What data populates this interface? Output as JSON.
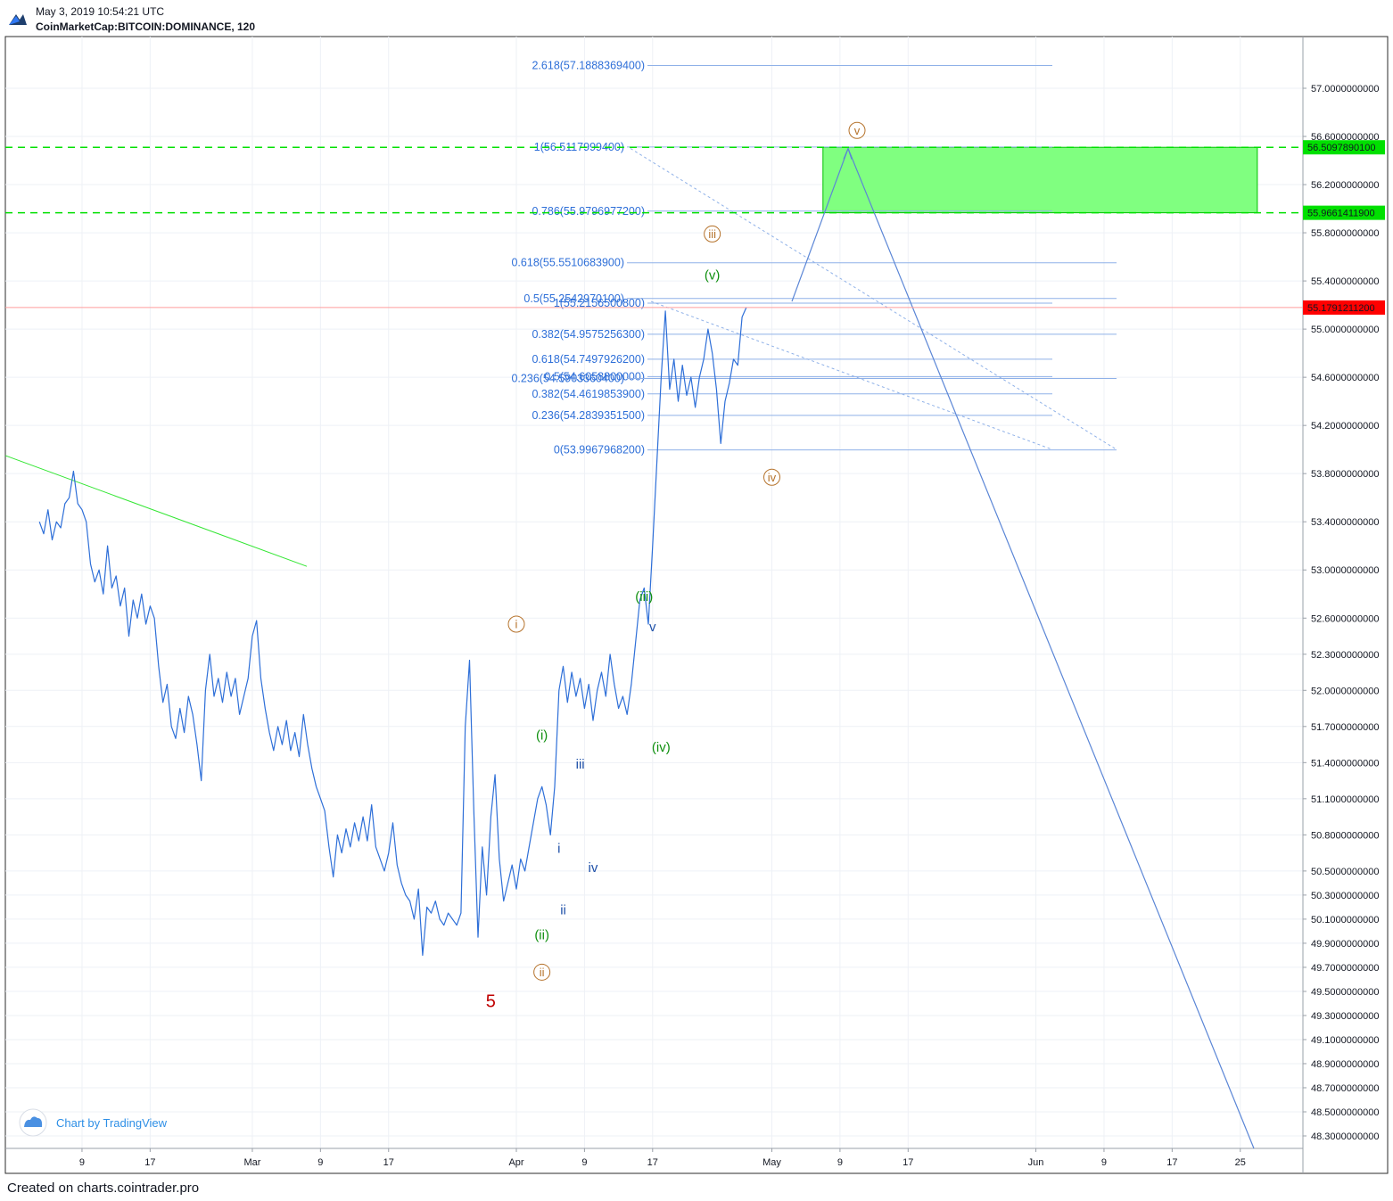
{
  "header": {
    "timestamp": "May 3, 2019 10:54:21 UTC",
    "symbol": "CoinMarketCap:BITCOIN:DOMINANCE, 120"
  },
  "footer": {
    "text": "Created on charts.cointrader.pro"
  },
  "watermark": {
    "text": "Chart by TradingView"
  },
  "colors": {
    "price_line": "#2e6fd8",
    "fib_line": "#8fb1e8",
    "fib_text": "#2e6fd8",
    "target_zone": "#80ff80",
    "target_border": "#00c000",
    "dashed_level": "#00e000",
    "last_price_badge": "#ff0000",
    "trend_line": "#33e633",
    "wave_orange": "#b5722b",
    "wave_green": "#109010",
    "wave_blue": "#1d4fa8",
    "wave_red": "#c00000"
  },
  "chart_data": {
    "type": "line",
    "x_axis": {
      "start_date": "2019-02-04",
      "end_date": "2019-06-30",
      "tick_labels": [
        "9",
        "17",
        "Mar",
        "9",
        "17",
        "Apr",
        "9",
        "17",
        "May",
        "9",
        "17",
        "Jun",
        "9",
        "17",
        "25"
      ],
      "tick_dates": [
        "2019-02-09",
        "2019-02-17",
        "2019-03-01",
        "2019-03-09",
        "2019-03-17",
        "2019-04-01",
        "2019-04-09",
        "2019-04-17",
        "2019-05-01",
        "2019-05-09",
        "2019-05-17",
        "2019-06-01",
        "2019-06-09",
        "2019-06-17",
        "2019-06-25"
      ]
    },
    "y_axis": {
      "ylim": [
        48.2,
        57.3
      ],
      "tick_values": [
        57.0,
        56.6,
        56.2,
        55.8,
        55.4,
        55.0,
        54.6,
        54.2,
        53.8,
        53.4,
        53.0,
        52.6,
        52.3,
        52.0,
        51.7,
        51.4,
        51.1,
        50.8,
        50.5,
        50.3,
        50.1,
        49.9,
        49.7,
        49.5,
        49.3,
        49.1,
        48.9,
        48.7,
        48.5,
        48.3
      ],
      "tick_labels": [
        "57.0000000000",
        "56.6000000000",
        "56.2000000000",
        "55.8000000000",
        "55.4000000000",
        "55.0000000000",
        "54.6000000000",
        "54.2000000000",
        "53.8000000000",
        "53.4000000000",
        "53.0000000000",
        "52.6000000000",
        "52.3000000000",
        "52.0000000000",
        "51.7000000000",
        "51.4000000000",
        "51.1000000000",
        "50.8000000000",
        "50.5000000000",
        "50.3000000000",
        "50.1000000000",
        "49.9000000000",
        "49.7000000000",
        "49.5000000000",
        "49.3000000000",
        "49.1000000000",
        "48.9000000000",
        "48.7000000000",
        "48.5000000000",
        "48.3000000000"
      ],
      "grid": true
    },
    "series": [
      {
        "points": [
          [
            "2019-02-04 00:00",
            53.4
          ],
          [
            "2019-02-04 12:00",
            53.3
          ],
          [
            "2019-02-05 00:00",
            53.5
          ],
          [
            "2019-02-05 12:00",
            53.25
          ],
          [
            "2019-02-06 00:00",
            53.4
          ],
          [
            "2019-02-06 12:00",
            53.35
          ],
          [
            "2019-02-07 00:00",
            53.55
          ],
          [
            "2019-02-07 12:00",
            53.6
          ],
          [
            "2019-02-08 00:00",
            53.82
          ],
          [
            "2019-02-08 12:00",
            53.55
          ],
          [
            "2019-02-09 00:00",
            53.5
          ],
          [
            "2019-02-09 12:00",
            53.4
          ],
          [
            "2019-02-10 00:00",
            53.05
          ],
          [
            "2019-02-10 12:00",
            52.9
          ],
          [
            "2019-02-11 00:00",
            53.0
          ],
          [
            "2019-02-11 12:00",
            52.8
          ],
          [
            "2019-02-12 00:00",
            53.2
          ],
          [
            "2019-02-12 12:00",
            52.85
          ],
          [
            "2019-02-13 00:00",
            52.95
          ],
          [
            "2019-02-13 12:00",
            52.7
          ],
          [
            "2019-02-14 00:00",
            52.85
          ],
          [
            "2019-02-14 12:00",
            52.45
          ],
          [
            "2019-02-15 00:00",
            52.75
          ],
          [
            "2019-02-15 12:00",
            52.6
          ],
          [
            "2019-02-16 00:00",
            52.8
          ],
          [
            "2019-02-16 12:00",
            52.55
          ],
          [
            "2019-02-17 00:00",
            52.7
          ],
          [
            "2019-02-17 12:00",
            52.6
          ],
          [
            "2019-02-18 00:00",
            52.2
          ],
          [
            "2019-02-18 12:00",
            51.9
          ],
          [
            "2019-02-19 00:00",
            52.05
          ],
          [
            "2019-02-19 12:00",
            51.7
          ],
          [
            "2019-02-20 00:00",
            51.6
          ],
          [
            "2019-02-20 12:00",
            51.85
          ],
          [
            "2019-02-21 00:00",
            51.65
          ],
          [
            "2019-02-21 12:00",
            51.95
          ],
          [
            "2019-02-22 00:00",
            51.8
          ],
          [
            "2019-02-22 12:00",
            51.55
          ],
          [
            "2019-02-23 00:00",
            51.25
          ],
          [
            "2019-02-23 12:00",
            52.0
          ],
          [
            "2019-02-24 00:00",
            52.3
          ],
          [
            "2019-02-24 12:00",
            51.95
          ],
          [
            "2019-02-25 00:00",
            52.1
          ],
          [
            "2019-02-25 12:00",
            51.9
          ],
          [
            "2019-02-26 00:00",
            52.15
          ],
          [
            "2019-02-26 12:00",
            51.95
          ],
          [
            "2019-02-27 00:00",
            52.1
          ],
          [
            "2019-02-27 12:00",
            51.8
          ],
          [
            "2019-02-28 00:00",
            51.95
          ],
          [
            "2019-02-28 12:00",
            52.1
          ],
          [
            "2019-03-01 00:00",
            52.45
          ],
          [
            "2019-03-01 12:00",
            52.58
          ],
          [
            "2019-03-02 00:00",
            52.1
          ],
          [
            "2019-03-02 12:00",
            51.85
          ],
          [
            "2019-03-03 00:00",
            51.65
          ],
          [
            "2019-03-03 12:00",
            51.5
          ],
          [
            "2019-03-04 00:00",
            51.7
          ],
          [
            "2019-03-04 12:00",
            51.55
          ],
          [
            "2019-03-05 00:00",
            51.75
          ],
          [
            "2019-03-05 12:00",
            51.5
          ],
          [
            "2019-03-06 00:00",
            51.65
          ],
          [
            "2019-03-06 12:00",
            51.45
          ],
          [
            "2019-03-07 00:00",
            51.8
          ],
          [
            "2019-03-07 12:00",
            51.55
          ],
          [
            "2019-03-08 00:00",
            51.35
          ],
          [
            "2019-03-08 12:00",
            51.2
          ],
          [
            "2019-03-09 00:00",
            51.1
          ],
          [
            "2019-03-09 12:00",
            51.0
          ],
          [
            "2019-03-10 00:00",
            50.7
          ],
          [
            "2019-03-10 12:00",
            50.45
          ],
          [
            "2019-03-11 00:00",
            50.8
          ],
          [
            "2019-03-11 12:00",
            50.65
          ],
          [
            "2019-03-12 00:00",
            50.85
          ],
          [
            "2019-03-12 12:00",
            50.7
          ],
          [
            "2019-03-13 00:00",
            50.9
          ],
          [
            "2019-03-13 12:00",
            50.75
          ],
          [
            "2019-03-14 00:00",
            50.95
          ],
          [
            "2019-03-14 12:00",
            50.75
          ],
          [
            "2019-03-15 00:00",
            51.05
          ],
          [
            "2019-03-15 12:00",
            50.7
          ],
          [
            "2019-03-16 00:00",
            50.6
          ],
          [
            "2019-03-16 12:00",
            50.5
          ],
          [
            "2019-03-17 00:00",
            50.65
          ],
          [
            "2019-03-17 12:00",
            50.9
          ],
          [
            "2019-03-18 00:00",
            50.55
          ],
          [
            "2019-03-18 12:00",
            50.4
          ],
          [
            "2019-03-19 00:00",
            50.3
          ],
          [
            "2019-03-19 12:00",
            50.25
          ],
          [
            "2019-03-20 00:00",
            50.1
          ],
          [
            "2019-03-20 12:00",
            50.35
          ],
          [
            "2019-03-21 00:00",
            49.8
          ],
          [
            "2019-03-21 12:00",
            50.2
          ],
          [
            "2019-03-22 00:00",
            50.15
          ],
          [
            "2019-03-22 12:00",
            50.25
          ],
          [
            "2019-03-23 00:00",
            50.1
          ],
          [
            "2019-03-23 12:00",
            50.05
          ],
          [
            "2019-03-24 00:00",
            50.15
          ],
          [
            "2019-03-24 12:00",
            50.1
          ],
          [
            "2019-03-25 00:00",
            50.05
          ],
          [
            "2019-03-25 12:00",
            50.15
          ],
          [
            "2019-03-26 00:00",
            51.7
          ],
          [
            "2019-03-26 12:00",
            52.25
          ],
          [
            "2019-03-27 00:00",
            51.0
          ],
          [
            "2019-03-27 12:00",
            49.95
          ],
          [
            "2019-03-28 00:00",
            50.7
          ],
          [
            "2019-03-28 12:00",
            50.3
          ],
          [
            "2019-03-29 00:00",
            50.95
          ],
          [
            "2019-03-29 12:00",
            51.3
          ],
          [
            "2019-03-30 00:00",
            50.6
          ],
          [
            "2019-03-30 12:00",
            50.25
          ],
          [
            "2019-03-31 00:00",
            50.4
          ],
          [
            "2019-03-31 12:00",
            50.55
          ],
          [
            "2019-04-01 00:00",
            50.35
          ],
          [
            "2019-04-01 12:00",
            50.6
          ],
          [
            "2019-04-02 00:00",
            50.5
          ],
          [
            "2019-04-02 12:00",
            50.7
          ],
          [
            "2019-04-03 00:00",
            50.9
          ],
          [
            "2019-04-03 12:00",
            51.1
          ],
          [
            "2019-04-04 00:00",
            51.2
          ],
          [
            "2019-04-04 12:00",
            51.05
          ],
          [
            "2019-04-05 00:00",
            50.8
          ],
          [
            "2019-04-05 12:00",
            51.2
          ],
          [
            "2019-04-06 00:00",
            52.0
          ],
          [
            "2019-04-06 12:00",
            52.2
          ],
          [
            "2019-04-07 00:00",
            51.9
          ],
          [
            "2019-04-07 12:00",
            52.15
          ],
          [
            "2019-04-08 00:00",
            51.95
          ],
          [
            "2019-04-08 12:00",
            52.1
          ],
          [
            "2019-04-09 00:00",
            51.85
          ],
          [
            "2019-04-09 12:00",
            52.05
          ],
          [
            "2019-04-10 00:00",
            51.75
          ],
          [
            "2019-04-10 12:00",
            52.0
          ],
          [
            "2019-04-11 00:00",
            52.15
          ],
          [
            "2019-04-11 12:00",
            51.95
          ],
          [
            "2019-04-12 00:00",
            52.3
          ],
          [
            "2019-04-12 12:00",
            52.05
          ],
          [
            "2019-04-13 00:00",
            51.85
          ],
          [
            "2019-04-13 12:00",
            51.95
          ],
          [
            "2019-04-14 00:00",
            51.8
          ],
          [
            "2019-04-14 12:00",
            52.05
          ],
          [
            "2019-04-15 00:00",
            52.4
          ],
          [
            "2019-04-15 12:00",
            52.75
          ],
          [
            "2019-04-16 00:00",
            52.85
          ],
          [
            "2019-04-16 12:00",
            52.55
          ],
          [
            "2019-04-17 00:00",
            53.2
          ],
          [
            "2019-04-17 12:00",
            53.9
          ],
          [
            "2019-04-18 00:00",
            54.6
          ],
          [
            "2019-04-18 12:00",
            55.15
          ],
          [
            "2019-04-19 00:00",
            54.5
          ],
          [
            "2019-04-19 12:00",
            54.75
          ],
          [
            "2019-04-20 00:00",
            54.4
          ],
          [
            "2019-04-20 12:00",
            54.7
          ],
          [
            "2019-04-21 00:00",
            54.45
          ],
          [
            "2019-04-21 12:00",
            54.6
          ],
          [
            "2019-04-22 00:00",
            54.35
          ],
          [
            "2019-04-22 12:00",
            54.6
          ],
          [
            "2019-04-23 00:00",
            54.75
          ],
          [
            "2019-04-23 12:00",
            55.0
          ],
          [
            "2019-04-24 00:00",
            54.8
          ],
          [
            "2019-04-24 12:00",
            54.5
          ],
          [
            "2019-04-25 00:00",
            54.05
          ],
          [
            "2019-04-25 12:00",
            54.4
          ],
          [
            "2019-04-26 00:00",
            54.55
          ],
          [
            "2019-04-26 12:00",
            54.75
          ],
          [
            "2019-04-27 00:00",
            54.7
          ],
          [
            "2019-04-27 12:00",
            55.1
          ],
          [
            "2019-04-28 00:00",
            55.18
          ]
        ]
      }
    ],
    "fibonacci_levels": [
      {
        "label": "2.618(57.1888369400)",
        "value": 57.18883694
      },
      {
        "label": "1(56.5117999400)",
        "value": 56.51179994
      },
      {
        "label": "0.786(55.9796977200)",
        "value": 55.97969772
      },
      {
        "label": "0.618(55.5510683900)",
        "value": 55.55106839
      },
      {
        "label": "0.5(55.2542970100)",
        "value": 55.25429701
      },
      {
        "label": "1(55.2156500800)",
        "value": 55.21565008
      },
      {
        "label": "0.382(54.9575256300)",
        "value": 54.95752563
      },
      {
        "label": "0.618(54.7497926200)",
        "value": 54.74979262
      },
      {
        "label": "0.5(54.6058800000)",
        "value": 54.60588
      },
      {
        "label": "0.236(54.5903360400)",
        "value": 54.59033604
      },
      {
        "label": "0.382(54.4619853900)",
        "value": 54.46198539
      },
      {
        "label": "0.236(54.2839351500)",
        "value": 54.28393515
      },
      {
        "label": "0(53.9967968200)",
        "value": 53.99679682
      }
    ],
    "horizontal_levels": [
      {
        "value": 56.50978901,
        "label": "56.5097890100",
        "style": "dashed-green"
      },
      {
        "value": 55.96614119,
        "label": "55.9661411900",
        "style": "dashed-green"
      },
      {
        "value": 55.17912112,
        "label": "55.1791211200",
        "style": "last-price"
      }
    ],
    "target_zone": {
      "from": "2019-05-07",
      "to": "2019-06-27",
      "y_low": 55.96614119,
      "y_high": 56.50978901
    },
    "wave_labels": [
      {
        "text": "v",
        "date": "2019-05-11 00:00",
        "y": 56.65,
        "color": "orange",
        "circled": true
      },
      {
        "text": "iii",
        "date": "2019-04-24 00:00",
        "y": 55.79,
        "color": "orange",
        "circled": true
      },
      {
        "text": "iv",
        "date": "2019-05-01 00:00",
        "y": 53.77,
        "color": "orange",
        "circled": true
      },
      {
        "text": "i",
        "date": "2019-04-01 00:00",
        "y": 52.55,
        "color": "orange",
        "circled": true
      },
      {
        "text": "ii",
        "date": "2019-04-04 00:00",
        "y": 49.66,
        "color": "orange",
        "circled": true
      },
      {
        "text": "(v)",
        "date": "2019-04-24 00:00",
        "y": 55.45,
        "color": "green",
        "circled": false
      },
      {
        "text": "(iii)",
        "date": "2019-04-16 00:00",
        "y": 52.78,
        "color": "green",
        "circled": false
      },
      {
        "text": "(iv)",
        "date": "2019-04-18 00:00",
        "y": 51.53,
        "color": "green",
        "circled": false
      },
      {
        "text": "(i)",
        "date": "2019-04-04 00:00",
        "y": 51.63,
        "color": "green",
        "circled": false
      },
      {
        "text": "(ii)",
        "date": "2019-04-04 00:00",
        "y": 49.97,
        "color": "green",
        "circled": false
      },
      {
        "text": "v",
        "date": "2019-04-17 00:00",
        "y": 52.53,
        "color": "blue",
        "circled": false
      },
      {
        "text": "iii",
        "date": "2019-04-08 12:00",
        "y": 51.39,
        "color": "blue",
        "circled": false
      },
      {
        "text": "i",
        "date": "2019-04-06 00:00",
        "y": 50.69,
        "color": "blue",
        "circled": false
      },
      {
        "text": "iv",
        "date": "2019-04-10 00:00",
        "y": 50.53,
        "color": "blue",
        "circled": false
      },
      {
        "text": "ii",
        "date": "2019-04-06 12:00",
        "y": 50.18,
        "color": "blue",
        "circled": false
      },
      {
        "text": "5",
        "date": "2019-03-29 00:00",
        "y": 49.42,
        "color": "red",
        "circled": false
      }
    ]
  }
}
